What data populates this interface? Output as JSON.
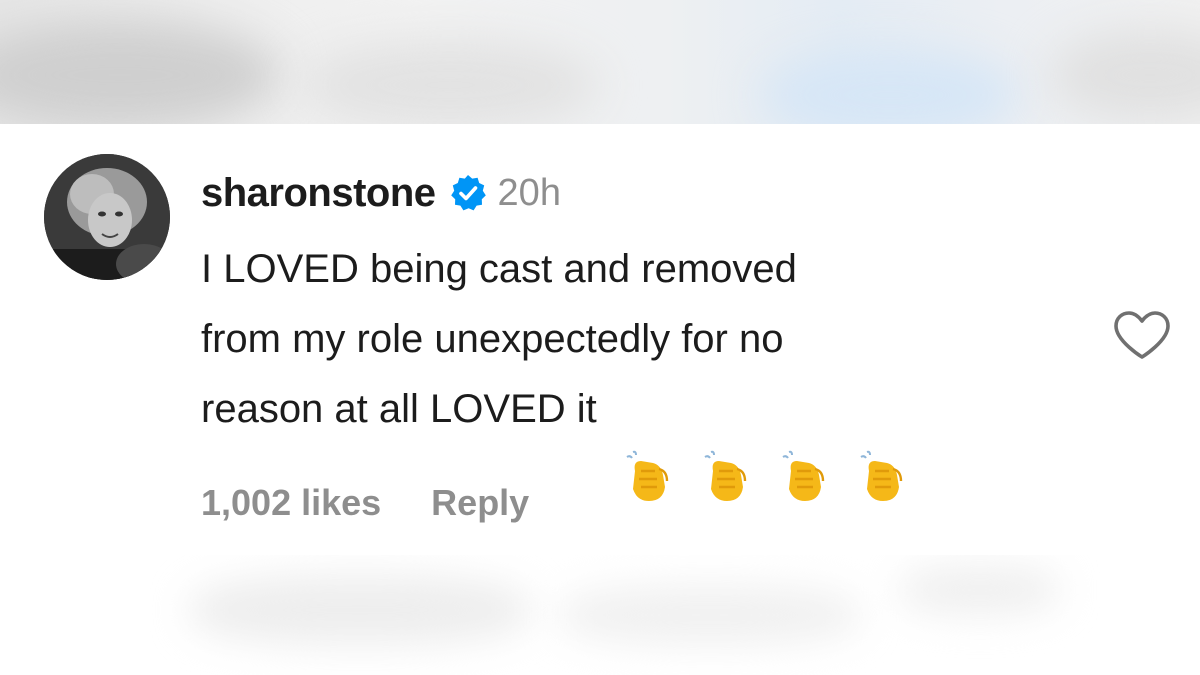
{
  "comment": {
    "username": "sharonstone",
    "verified": true,
    "timestamp": "20h",
    "text": "I LOVED being cast and removed\nfrom my role unexpectedly for no\nreason at all LOVED it",
    "emoji": [
      "clapping-hands",
      "clapping-hands",
      "clapping-hands",
      "clapping-hands"
    ],
    "likes": "1,002 likes",
    "reply_label": "Reply"
  },
  "colors": {
    "text": "#1c1c1c",
    "muted": "#8e8e8e",
    "verified_blue": "#0095f6",
    "emoji_yellow": "#f5b818"
  },
  "icons": {
    "verified": "verified-badge-icon",
    "like": "heart-outline-icon",
    "emoji": "clapping-hands-icon"
  }
}
